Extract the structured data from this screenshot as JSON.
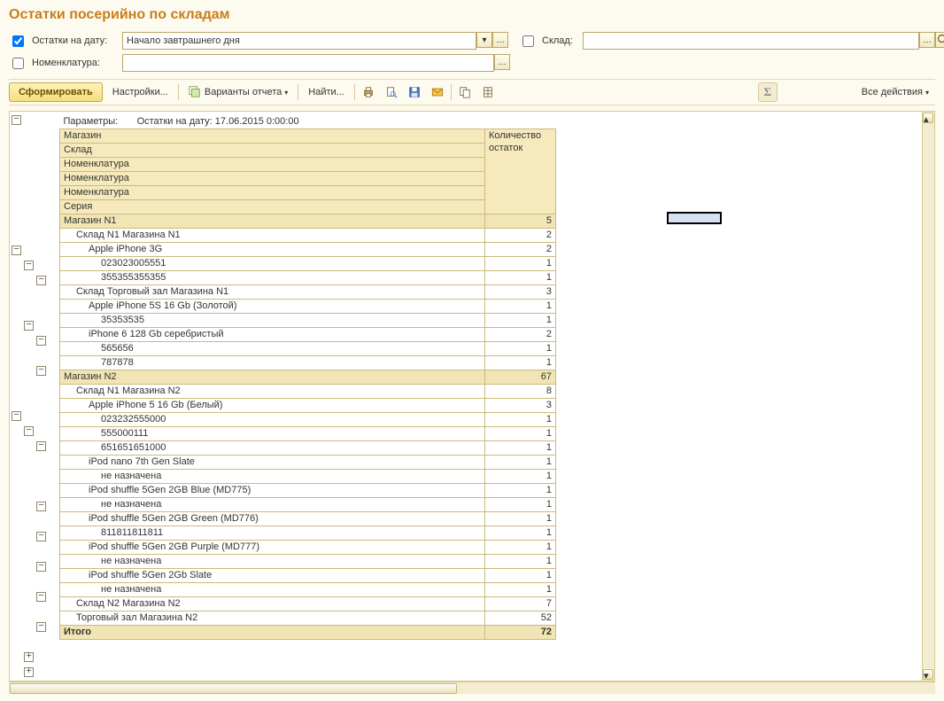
{
  "title": "Остатки посерийно по складам",
  "filters": {
    "date_label": "Остатки на дату:",
    "date_value": "Начало завтрашнего дня",
    "warehouse_label": "Склад:",
    "warehouse_value": "",
    "nomenclature_label": "Номенклатура:",
    "nomenclature_value": ""
  },
  "toolbar": {
    "form_label": "Сформировать",
    "settings_label": "Настройки...",
    "variants_label": "Варианты отчета",
    "find_label": "Найти...",
    "all_actions_label": "Все действия"
  },
  "params": {
    "caption": "Параметры:",
    "text": "Остатки на дату: 17.06.2015 0:00:00"
  },
  "headers": {
    "group_rows": [
      "Магазин",
      "Склад",
      "Номенклатура",
      "Номенклатура",
      "Номенклатура",
      "Серия"
    ],
    "qty_header_1": "Количество",
    "qty_header_2": "остаток"
  },
  "total_label": "Итого",
  "total_value": 72,
  "rows": [
    {
      "level": 0,
      "type": "store",
      "name": "Магазин N1",
      "qty": 5,
      "node": "-",
      "nodeCol": 0
    },
    {
      "level": 1,
      "type": "reg",
      "name": "Склад N1 Магазина N1",
      "qty": 2,
      "node": "-",
      "nodeCol": 1
    },
    {
      "level": 2,
      "type": "reg",
      "name": "Apple iPhone 3G",
      "qty": 2,
      "node": "-",
      "nodeCol": 2
    },
    {
      "level": 3,
      "type": "reg",
      "name": "023023005551",
      "qty": 1
    },
    {
      "level": 3,
      "type": "reg",
      "name": "355355355355",
      "qty": 1
    },
    {
      "level": 1,
      "type": "reg",
      "name": "Склад Торговый зал Магазина N1",
      "qty": 3,
      "node": "-",
      "nodeCol": 1
    },
    {
      "level": 2,
      "type": "reg",
      "name": "Apple iPhone 5S 16 Gb (Золотой)",
      "qty": 1,
      "node": "-",
      "nodeCol": 2
    },
    {
      "level": 3,
      "type": "reg",
      "name": "35353535",
      "qty": 1
    },
    {
      "level": 2,
      "type": "reg",
      "name": "iPhone 6 128 Gb серебристый",
      "qty": 2,
      "node": "-",
      "nodeCol": 2
    },
    {
      "level": 3,
      "type": "reg",
      "name": "565656",
      "qty": 1
    },
    {
      "level": 3,
      "type": "reg",
      "name": "787878",
      "qty": 1
    },
    {
      "level": 0,
      "type": "store",
      "name": "Магазин N2",
      "qty": 67,
      "node": "-",
      "nodeCol": 0
    },
    {
      "level": 1,
      "type": "reg",
      "name": "Склад N1 Магазина N2",
      "qty": 8,
      "node": "-",
      "nodeCol": 1
    },
    {
      "level": 2,
      "type": "reg",
      "name": "Apple iPhone 5 16 Gb (Белый)",
      "qty": 3,
      "node": "-",
      "nodeCol": 2
    },
    {
      "level": 3,
      "type": "reg",
      "name": "023232555000",
      "qty": 1
    },
    {
      "level": 3,
      "type": "reg",
      "name": "555000111",
      "qty": 1
    },
    {
      "level": 3,
      "type": "reg",
      "name": "651651651000",
      "qty": 1
    },
    {
      "level": 2,
      "type": "reg",
      "name": "iPod nano 7th Gen Slate",
      "qty": 1,
      "node": "-",
      "nodeCol": 2
    },
    {
      "level": 3,
      "type": "reg",
      "name": "не назначена",
      "qty": 1
    },
    {
      "level": 2,
      "type": "reg",
      "name": "iPod shuffle 5Gen 2GB Blue (MD775)",
      "qty": 1,
      "node": "-",
      "nodeCol": 2
    },
    {
      "level": 3,
      "type": "reg",
      "name": "не назначена",
      "qty": 1
    },
    {
      "level": 2,
      "type": "reg",
      "name": "iPod shuffle 5Gen 2GB Green (MD776)",
      "qty": 1,
      "node": "-",
      "nodeCol": 2
    },
    {
      "level": 3,
      "type": "reg",
      "name": "811811811811",
      "qty": 1
    },
    {
      "level": 2,
      "type": "reg",
      "name": "iPod shuffle 5Gen 2GB Purple (MD777)",
      "qty": 1,
      "node": "-",
      "nodeCol": 2
    },
    {
      "level": 3,
      "type": "reg",
      "name": "не назначена",
      "qty": 1
    },
    {
      "level": 2,
      "type": "reg",
      "name": "iPod shuffle 5Gen 2Gb Slate",
      "qty": 1,
      "node": "-",
      "nodeCol": 2
    },
    {
      "level": 3,
      "type": "reg",
      "name": "не назначена",
      "qty": 1
    },
    {
      "level": 1,
      "type": "reg",
      "name": "Склад N2 Магазина N2",
      "qty": 7,
      "node": "+",
      "nodeCol": 1
    },
    {
      "level": 1,
      "type": "reg",
      "name": "Торговый зал Магазина N2",
      "qty": 52,
      "node": "+",
      "nodeCol": 1
    }
  ]
}
